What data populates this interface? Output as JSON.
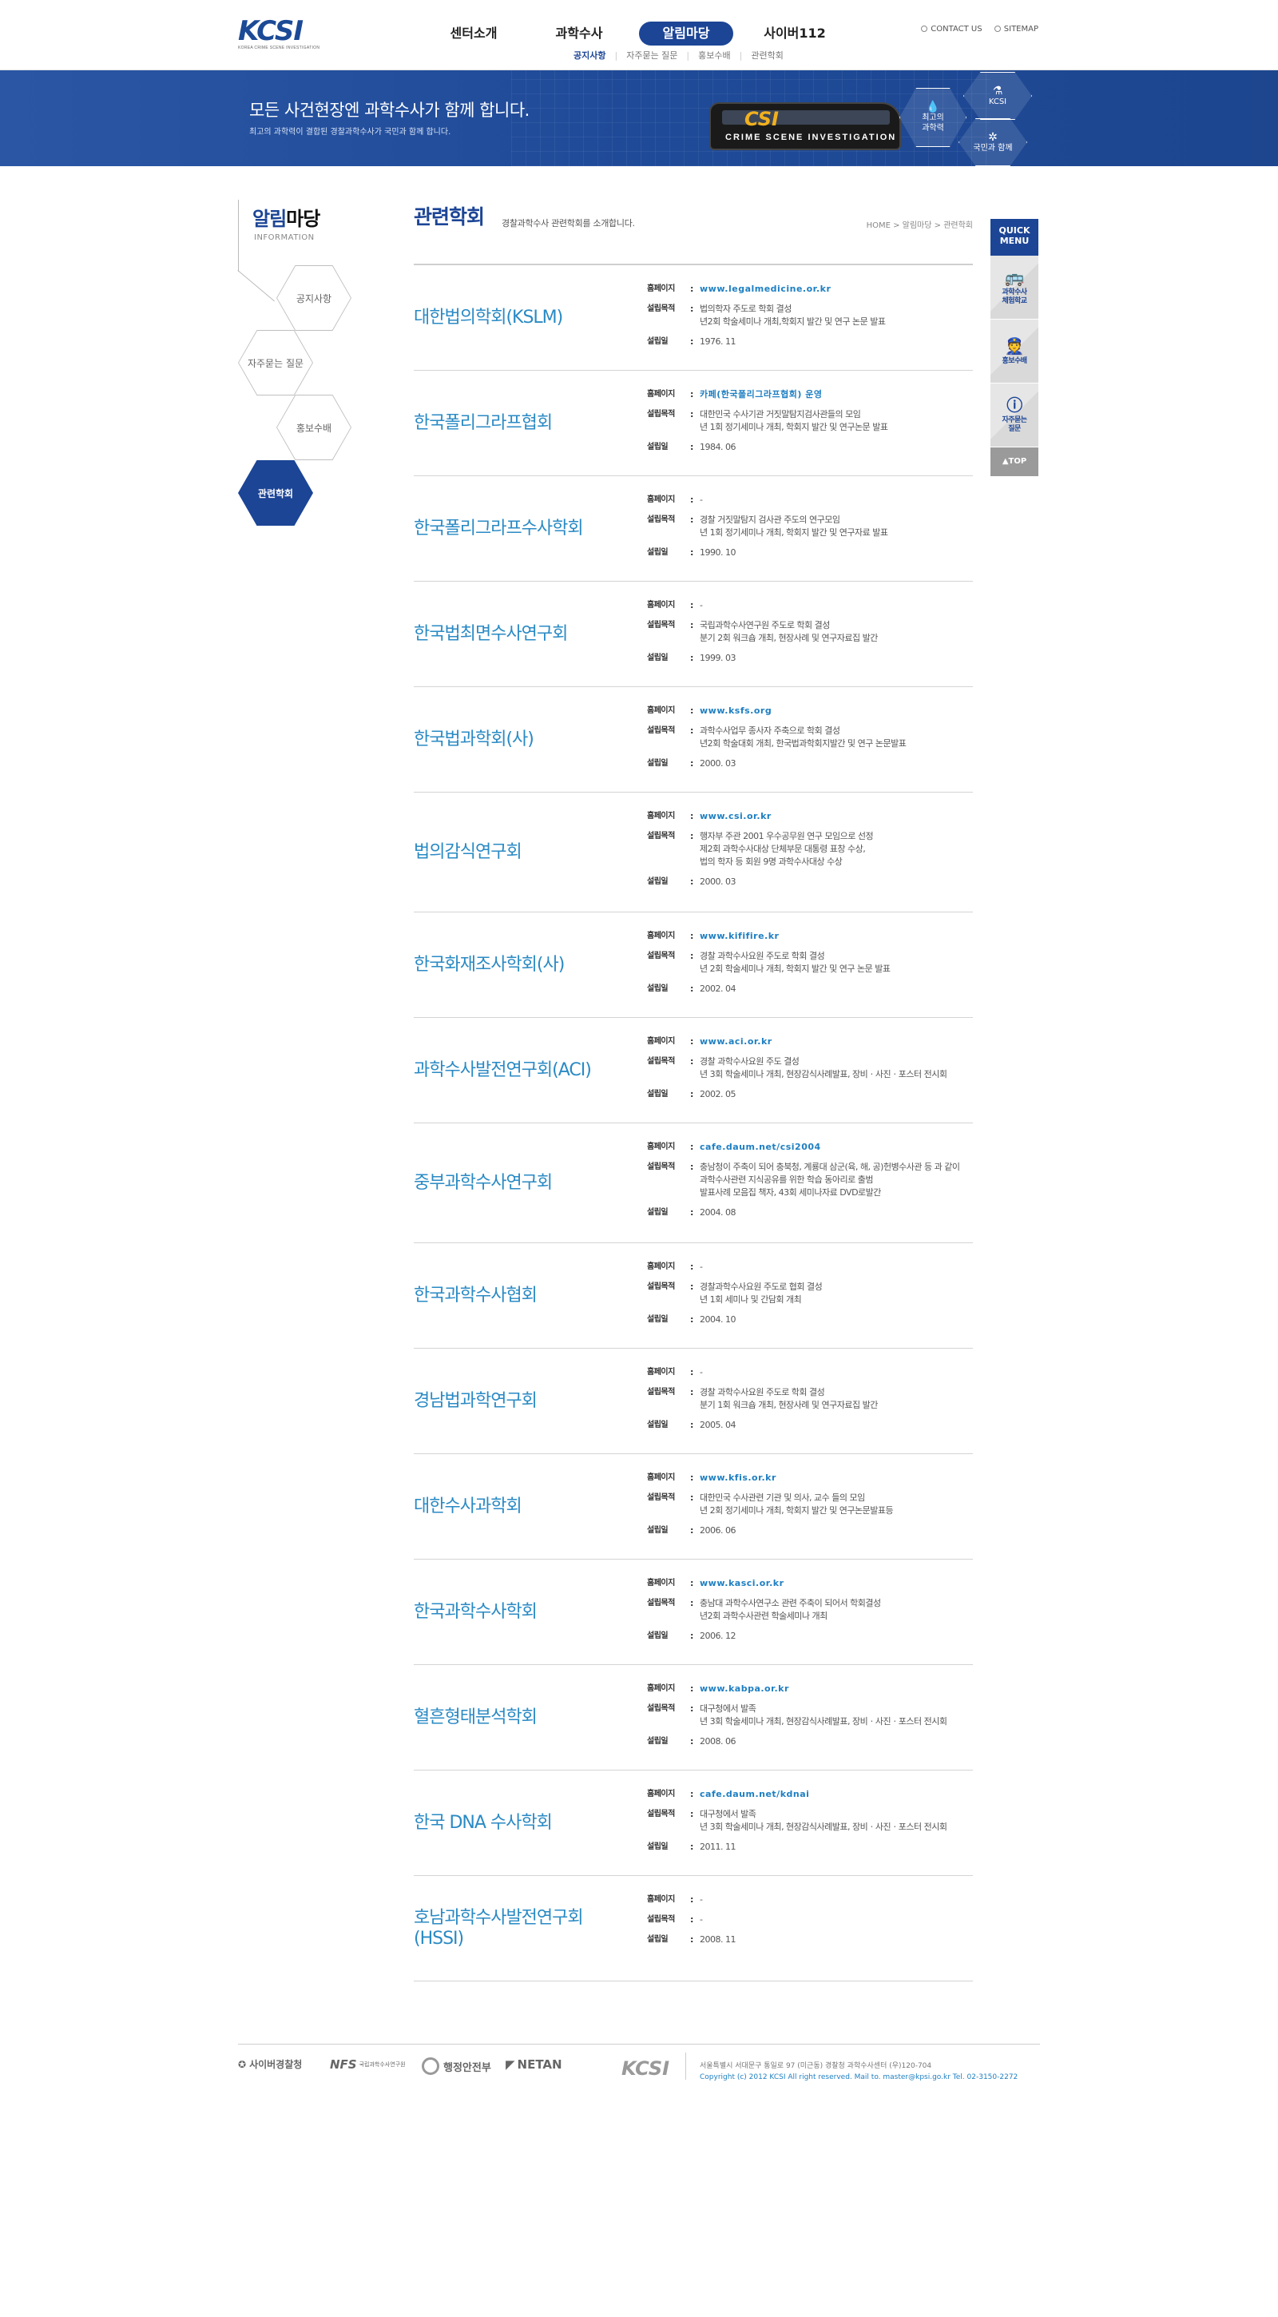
{
  "header": {
    "logo_text": "KCSI",
    "logo_sub": "KOREA CRIME SCENE INVESTIGATION",
    "gnb": [
      {
        "label": "센터소개",
        "active": false
      },
      {
        "label": "과학수사",
        "active": false
      },
      {
        "label": "알림마당",
        "active": true
      },
      {
        "label": "사이버112",
        "active": false
      }
    ],
    "sub_nav": [
      {
        "label": "공지사항",
        "active": true
      },
      {
        "label": "자주묻는 질문",
        "active": false
      },
      {
        "label": "홍보수배",
        "active": false
      },
      {
        "label": "관련학회",
        "active": false
      }
    ],
    "util": {
      "contact": "CONTACT US",
      "sitemap": "SITEMAP"
    }
  },
  "banner": {
    "headline": "모든 사건현장엔 과학수사가 함께 합니다.",
    "subline": "최고의 과학력이 결합된 경찰과학수사가 국민과 함께 합니다.",
    "bus_text": "CSI",
    "bus_sub": "CRIME SCENE INVESTIGATION",
    "hex_labels": [
      "KCSI",
      "최고의\n과학력",
      "국민과 함께"
    ],
    "accent_color": "#1f4a98"
  },
  "lnb": {
    "title_a": "알림",
    "title_b": "마당",
    "subtitle": "INFORMATION",
    "items": [
      {
        "label": "공지사항",
        "active": false
      },
      {
        "label": "자주묻는 질문",
        "active": false
      },
      {
        "label": "홍보수배",
        "active": false
      },
      {
        "label": "관련학회",
        "active": true
      }
    ]
  },
  "content": {
    "title": "관련학회",
    "description": "경찰과학수사 관련학회를 소개합니다.",
    "breadcrumb": "HOME > 알림마당 > 관련학회",
    "labels": {
      "homepage": "홈페이지",
      "purpose": "설립목적",
      "founded": "설립일",
      "colon": ":"
    },
    "societies": [
      {
        "name": "대한법의학회(KSLM)",
        "homepage": "www.legalmedicine.or.kr",
        "purpose": "법의학자 주도로 학회 결성\n년2회 학술세미나 개최,학회지 발간 및 연구 논문 발표",
        "founded": "1976. 11"
      },
      {
        "name": "한국폴리그라프협회",
        "homepage": "카페(한국폴리그라프협회) 운영",
        "purpose": "대한민국 수사기관 거짓말탐지검사관들의 모임\n년 1회 정기세미나 개최, 학회지 발간 및 연구논문 발표",
        "founded": "1984. 06"
      },
      {
        "name": "한국폴리그라프수사학회",
        "homepage": "-",
        "purpose": "경찰 거짓말탐지 검사관 주도의 연구모임\n년 1회 정기세미나 개최, 학회지 발간 및 연구자료 발표",
        "founded": "1990. 10"
      },
      {
        "name": "한국법최면수사연구회",
        "homepage": "-",
        "purpose": "국립과학수사연구원 주도로 학회 결성\n분기 2회 워크숍 개최, 현장사례 및 연구자료집 발간",
        "founded": "1999. 03"
      },
      {
        "name": "한국법과학회(사)",
        "homepage": "www.ksfs.org",
        "purpose": "과학수사업무 종사자 주축으로 학회 결성\n년2회 학술대회 개최, 한국법과학회지발간 및 연구 논문발표",
        "founded": "2000. 03"
      },
      {
        "name": "법의감식연구회",
        "homepage": "www.csi.or.kr",
        "purpose": "행자부 주관 2001 우수공무원 연구 모임으로 선정\n제2회 과학수사대상 단체부문 대통령 표창 수상,\n법의 학자 등 회원 9명 과학수사대상 수상",
        "founded": "2000. 03"
      },
      {
        "name": "한국화재조사학회(사)",
        "homepage": "www.kififire.kr",
        "purpose": "경찰 과학수사요원 주도로 학회 결성\n년 2회 학술세미나 개최, 학회지 발간 및 연구 논문 발표",
        "founded": "2002. 04"
      },
      {
        "name": "과학수사발전연구회(ACI)",
        "homepage": "www.aci.or.kr",
        "purpose": "경찰 과학수사요원 주도 결성\n년 3회 학술세미나 개최, 현장감식사례발표, 장비ㆍ사진ㆍ포스터 전시회",
        "founded": "2002. 05"
      },
      {
        "name": "중부과학수사연구회",
        "homepage": "cafe.daum.net/csi2004",
        "purpose": "충남청이 주축이 되어 충북청, 계룡대 삼군(육, 해, 공)헌병수사관 등 과 같이\n과학수사관련 지식공유를 위한 학습 동아리로 출범\n발표사례 모음집 책자, 43회 세미나자료 DVD로발간",
        "founded": "2004. 08"
      },
      {
        "name": "한국과학수사협회",
        "homepage": "-",
        "purpose": "경찰과학수사요원 주도로 협회 결성\n년 1회 세미나 및 간담회 개최",
        "founded": "2004. 10"
      },
      {
        "name": "경남법과학연구회",
        "homepage": "-",
        "purpose": "경찰 과학수사요원 주도로 학회 결성\n분기 1회 워크숍 개최, 현장사례 및 연구자료집 발간",
        "founded": "2005. 04"
      },
      {
        "name": "대한수사과학회",
        "homepage": "www.kfis.or.kr",
        "purpose": "대한민국 수사관련 기관 및 의사, 교수 들의 모임\n년 2회 정기세미나 개최, 학회지 발간 및 연구논문발표등",
        "founded": "2006. 06"
      },
      {
        "name": "한국과학수사학회",
        "homepage": "www.kasci.or.kr",
        "purpose": "충남대 과학수사연구소 관련 주축이 되어서 학회결성\n년2회 과학수사관련 학술세미나 개최",
        "founded": "2006. 12"
      },
      {
        "name": "혈흔형태분석학회",
        "homepage": "www.kabpa.or.kr",
        "purpose": "대구청에서 발족\n년 3회 학술세미나 개최, 현장감식사례발표, 장비ㆍ사진ㆍ포스터 전시회",
        "founded": "2008. 06"
      },
      {
        "name": "한국 DNA 수사학회",
        "homepage": "cafe.daum.net/kdnai",
        "purpose": "대구청에서 발족\n년 3회 학술세미나 개최, 현장감식사례발표, 장비ㆍ사진ㆍ포스터 전시회",
        "founded": "2011. 11"
      },
      {
        "name": "호남과학수사발전연구회\n(HSSI)",
        "homepage": "-",
        "purpose": "-",
        "founded": "2008. 11"
      }
    ]
  },
  "quick_menu": {
    "title": "QUICK\nMENU",
    "items": [
      {
        "label": "과학수사\n체험학교",
        "icon": "bus-icon"
      },
      {
        "label": "홍보수배",
        "icon": "wanted-icon"
      },
      {
        "label": "자주묻는\n질문",
        "icon": "question-icon"
      }
    ],
    "top": "▲TOP"
  },
  "footer": {
    "logos": [
      "사이버경찰청",
      "NFS",
      "국립과학수사연구원",
      "행정안전부",
      "NETAN",
      "KCSI"
    ],
    "address": "서울특별시 서대문구 통일로 97 (미근동) 경찰청 과학수사센터 (우)120-704",
    "copyright": "Copyright (c) 2012 KCSI All right reserved. Mail to. master@kpsi.go.kr Tel. 02-3150-2272"
  }
}
